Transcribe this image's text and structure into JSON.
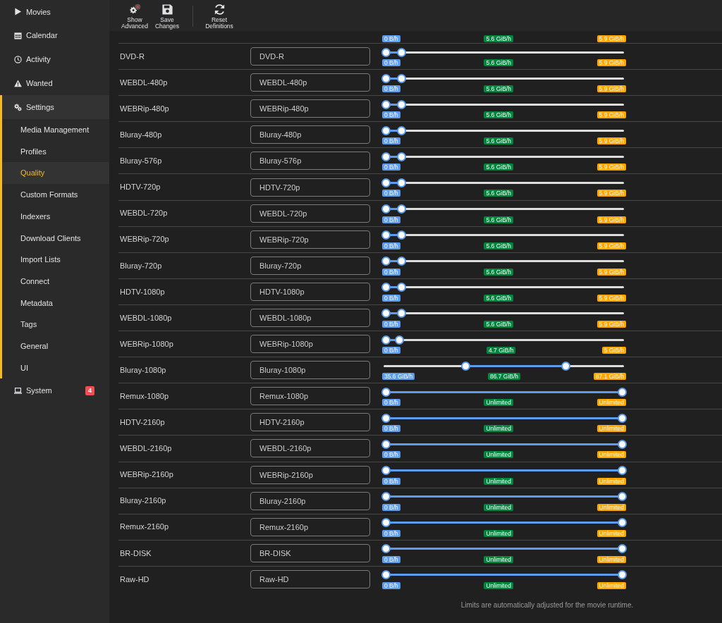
{
  "sidebar": {
    "items": [
      {
        "label": "Movies",
        "selected": false
      },
      {
        "label": "Calendar",
        "selected": false
      },
      {
        "label": "Activity",
        "selected": false
      },
      {
        "label": "Wanted",
        "selected": false
      },
      {
        "label": "Settings",
        "selected": true,
        "children": [
          {
            "label": "Media Management",
            "selected": false
          },
          {
            "label": "Profiles",
            "selected": false
          },
          {
            "label": "Quality",
            "selected": true
          },
          {
            "label": "Custom Formats",
            "selected": false
          },
          {
            "label": "Indexers",
            "selected": false
          },
          {
            "label": "Download Clients",
            "selected": false
          },
          {
            "label": "Import Lists",
            "selected": false
          },
          {
            "label": "Connect",
            "selected": false
          },
          {
            "label": "Metadata",
            "selected": false
          },
          {
            "label": "Tags",
            "selected": false
          },
          {
            "label": "General",
            "selected": false
          },
          {
            "label": "UI",
            "selected": false
          }
        ]
      },
      {
        "label": "System",
        "selected": false,
        "badge": "4"
      }
    ]
  },
  "toolbar": {
    "groups": [
      [
        {
          "label": "Show Advanced"
        },
        {
          "label": "Save Changes"
        }
      ],
      [
        {
          "label": "Reset Definitions"
        }
      ]
    ]
  },
  "cut_off_row": {
    "min_label": "0 B/h",
    "mid_label": "5.6 GiB/h",
    "max_label": "5.9 GiB/h"
  },
  "qualities": [
    {
      "name": "DVD-R",
      "title": "DVD-R",
      "thumbs": [
        {
          "level": 0
        },
        {
          "level": 0.066
        }
      ],
      "min_label": "0 B/h",
      "mid_label": "5.6 GiB/h",
      "max_label": "5.9 GiB/h"
    },
    {
      "name": "WEBDL-480p",
      "title": "WEBDL-480p",
      "thumbs": [
        {
          "level": 0
        },
        {
          "level": 0.066
        }
      ],
      "min_label": "0 B/h",
      "mid_label": "5.6 GiB/h",
      "max_label": "5.9 GiB/h"
    },
    {
      "name": "WEBRip-480p",
      "title": "WEBRip-480p",
      "thumbs": [
        {
          "level": 0
        },
        {
          "level": 0.066
        }
      ],
      "min_label": "0 B/h",
      "mid_label": "5.6 GiB/h",
      "max_label": "5.9 GiB/h"
    },
    {
      "name": "Bluray-480p",
      "title": "Bluray-480p",
      "thumbs": [
        {
          "level": 0
        },
        {
          "level": 0.066
        }
      ],
      "min_label": "0 B/h",
      "mid_label": "5.6 GiB/h",
      "max_label": "5.9 GiB/h"
    },
    {
      "name": "Bluray-576p",
      "title": "Bluray-576p",
      "thumbs": [
        {
          "level": 0
        },
        {
          "level": 0.066
        }
      ],
      "min_label": "0 B/h",
      "mid_label": "5.6 GiB/h",
      "max_label": "5.9 GiB/h"
    },
    {
      "name": "HDTV-720p",
      "title": "HDTV-720p",
      "thumbs": [
        {
          "level": 0
        },
        {
          "level": 0.066
        }
      ],
      "min_label": "0 B/h",
      "mid_label": "5.6 GiB/h",
      "max_label": "5.9 GiB/h"
    },
    {
      "name": "WEBDL-720p",
      "title": "WEBDL-720p",
      "thumbs": [
        {
          "level": 0
        },
        {
          "level": 0.066
        }
      ],
      "min_label": "0 B/h",
      "mid_label": "5.6 GiB/h",
      "max_label": "5.9 GiB/h"
    },
    {
      "name": "WEBRip-720p",
      "title": "WEBRip-720p",
      "thumbs": [
        {
          "level": 0
        },
        {
          "level": 0.066
        }
      ],
      "min_label": "0 B/h",
      "mid_label": "5.6 GiB/h",
      "max_label": "5.9 GiB/h"
    },
    {
      "name": "Bluray-720p",
      "title": "Bluray-720p",
      "thumbs": [
        {
          "level": 0
        },
        {
          "level": 0.066
        }
      ],
      "min_label": "0 B/h",
      "mid_label": "5.6 GiB/h",
      "max_label": "5.9 GiB/h"
    },
    {
      "name": "HDTV-1080p",
      "title": "HDTV-1080p",
      "thumbs": [
        {
          "level": 0
        },
        {
          "level": 0.066
        }
      ],
      "min_label": "0 B/h",
      "mid_label": "5.6 GiB/h",
      "max_label": "5.9 GiB/h"
    },
    {
      "name": "WEBDL-1080p",
      "title": "WEBDL-1080p",
      "thumbs": [
        {
          "level": 0
        },
        {
          "level": 0.066
        }
      ],
      "min_label": "0 B/h",
      "mid_label": "5.6 GiB/h",
      "max_label": "5.9 GiB/h"
    },
    {
      "name": "WEBRip-1080p",
      "title": "WEBRip-1080p",
      "thumbs": [
        {
          "level": 0
        },
        {
          "level": 0.057
        }
      ],
      "min_label": "0 B/h",
      "mid_label": "4.7 GiB/h",
      "max_label": "5 GiB/h"
    },
    {
      "name": "Bluray-1080p",
      "title": "Bluray-1080p",
      "thumbs": [
        {
          "level": 0.339
        },
        {
          "level": 0.764
        }
      ],
      "min_label": "35.6 GiB/h",
      "mid_label": "86.7 GiB/h",
      "max_label": "87.1 GiB/h"
    },
    {
      "name": "Remux-1080p",
      "title": "Remux-1080p",
      "thumbs": [
        {
          "level": 0
        },
        {
          "level": 1
        }
      ],
      "min_label": "0 B/h",
      "mid_label": "Unlimited",
      "max_label": "Unlimited"
    },
    {
      "name": "HDTV-2160p",
      "title": "HDTV-2160p",
      "thumbs": [
        {
          "level": 0
        },
        {
          "level": 1
        }
      ],
      "min_label": "0 B/h",
      "mid_label": "Unlimited",
      "max_label": "Unlimited"
    },
    {
      "name": "WEBDL-2160p",
      "title": "WEBDL-2160p",
      "thumbs": [
        {
          "level": 0
        },
        {
          "level": 1
        }
      ],
      "min_label": "0 B/h",
      "mid_label": "Unlimited",
      "max_label": "Unlimited"
    },
    {
      "name": "WEBRip-2160p",
      "title": "WEBRip-2160p",
      "thumbs": [
        {
          "level": 0
        },
        {
          "level": 1
        }
      ],
      "min_label": "0 B/h",
      "mid_label": "Unlimited",
      "max_label": "Unlimited"
    },
    {
      "name": "Bluray-2160p",
      "title": "Bluray-2160p",
      "thumbs": [
        {
          "level": 0
        },
        {
          "level": 1
        }
      ],
      "min_label": "0 B/h",
      "mid_label": "Unlimited",
      "max_label": "Unlimited"
    },
    {
      "name": "Remux-2160p",
      "title": "Remux-2160p",
      "thumbs": [
        {
          "level": 0
        },
        {
          "level": 1
        }
      ],
      "min_label": "0 B/h",
      "mid_label": "Unlimited",
      "max_label": "Unlimited"
    },
    {
      "name": "BR-DISK",
      "title": "BR-DISK",
      "thumbs": [
        {
          "level": 0
        },
        {
          "level": 1
        }
      ],
      "min_label": "0 B/h",
      "mid_label": "Unlimited",
      "max_label": "Unlimited"
    },
    {
      "name": "Raw-HD",
      "title": "Raw-HD",
      "thumbs": [
        {
          "level": 0
        },
        {
          "level": 1
        }
      ],
      "min_label": "0 B/h",
      "mid_label": "Unlimited",
      "max_label": "Unlimited"
    }
  ],
  "note": "Limits are automatically adjusted for the movie runtime."
}
